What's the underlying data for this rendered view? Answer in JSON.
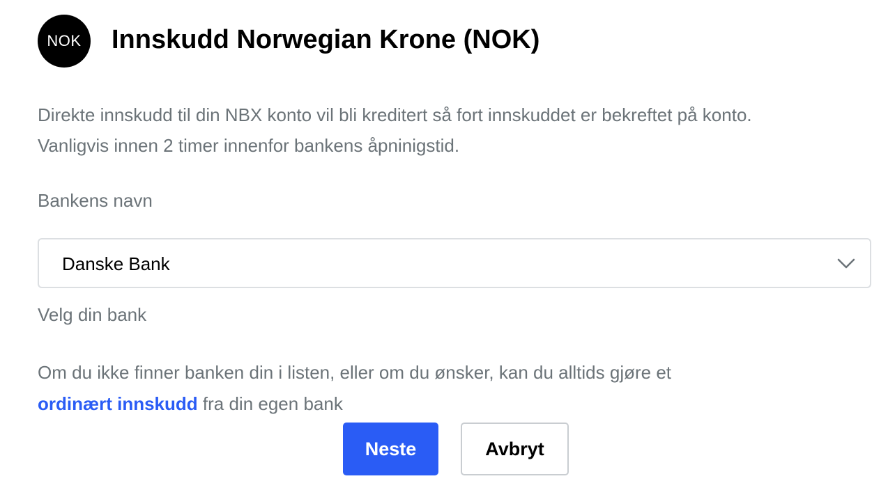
{
  "header": {
    "currency_badge": "NOK",
    "title": "Innskudd Norwegian Krone (NOK)"
  },
  "description": {
    "line1": "Direkte innskudd til din NBX konto vil bli kreditert så fort innskuddet er bekreftet på konto.",
    "line2": "Vanligvis innen 2 timer innenfor bankens åpninigstid."
  },
  "bank_select": {
    "label": "Bankens navn",
    "selected_value": "Danske Bank",
    "hint": "Velg din bank",
    "icon": "chevron-down-icon"
  },
  "note": {
    "text_before": "Om du ikke finner banken din i listen, eller om du ønsker, kan du alltids gjøre et",
    "link_text": "ordinært innskudd",
    "text_after": " fra din egen bank"
  },
  "actions": {
    "next_label": "Neste",
    "cancel_label": "Avbryt"
  },
  "colors": {
    "accent": "#2a5cf5",
    "muted_text": "#6b7378",
    "badge_bg": "#000000"
  }
}
